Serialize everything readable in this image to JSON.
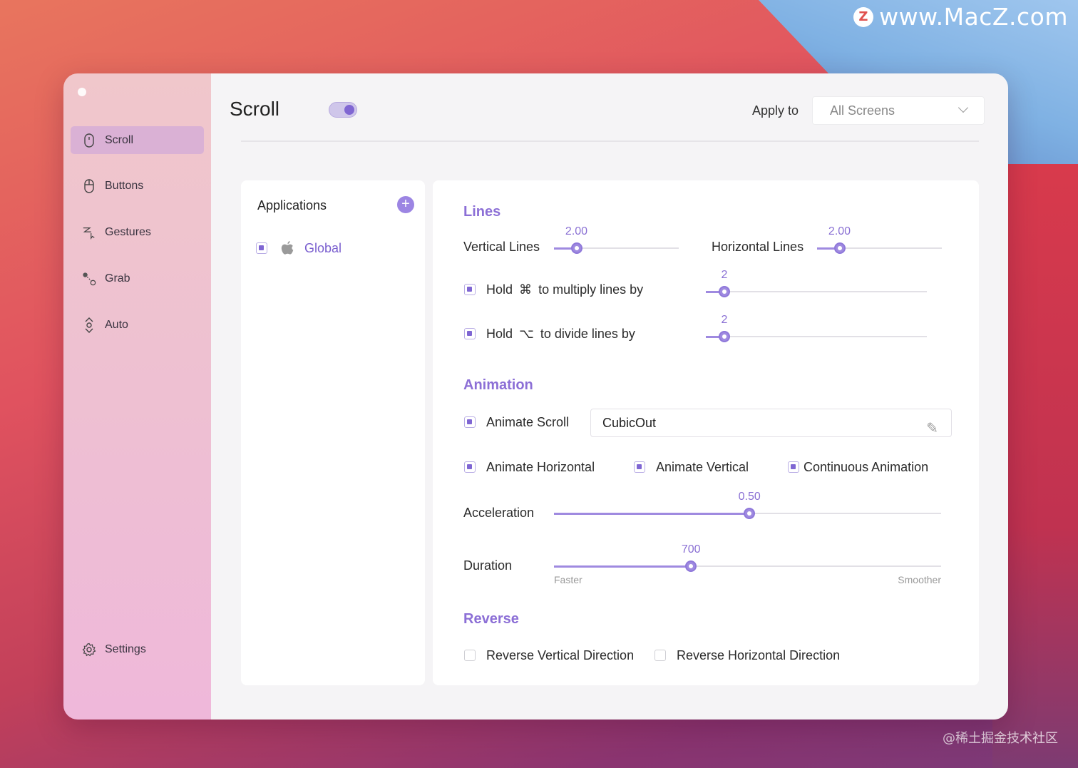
{
  "watermark": {
    "logo": "Z",
    "site": "www.MacZ.com",
    "bottom": "@稀土掘金技术社区"
  },
  "sidebar": {
    "items": [
      {
        "label": "Scroll",
        "icon": "mouse-icon"
      },
      {
        "label": "Buttons",
        "icon": "mouse-button-icon"
      },
      {
        "label": "Gestures",
        "icon": "gesture-icon"
      },
      {
        "label": "Grab",
        "icon": "grab-icon"
      },
      {
        "label": "Auto",
        "icon": "auto-scroll-icon"
      }
    ],
    "settings_label": "Settings"
  },
  "header": {
    "title": "Scroll",
    "toggle_on": true,
    "apply_label": "Apply to",
    "apply_value": "All Screens"
  },
  "apps": {
    "title": "Applications",
    "add_symbol": "+",
    "items": [
      {
        "label": "Global",
        "checked": true,
        "icon": "apple-icon"
      }
    ]
  },
  "lines": {
    "title": "Lines",
    "vertical_label": "Vertical Lines",
    "vertical_value": "2.00",
    "vertical_fraction": 0.18,
    "horizontal_label": "Horizontal Lines",
    "horizontal_value": "2.00",
    "horizontal_fraction": 0.18,
    "hold_cmd_prefix": "Hold",
    "hold_cmd_symbol": "⌘",
    "hold_cmd_suffix": "to multiply lines by",
    "hold_cmd_value": "2",
    "hold_cmd_checked": true,
    "hold_opt_prefix": "Hold",
    "hold_opt_symbol": "⌥",
    "hold_opt_suffix": "to divide lines by",
    "hold_opt_value": "2",
    "hold_opt_checked": true
  },
  "animation": {
    "title": "Animation",
    "animate_scroll_label": "Animate Scroll",
    "animate_scroll_checked": true,
    "curve_value": "CubicOut",
    "animate_horizontal_label": "Animate Horizontal",
    "animate_horizontal_checked": true,
    "animate_vertical_label": "Animate Vertical",
    "animate_vertical_checked": true,
    "continuous_label": "Continuous Animation",
    "continuous_checked": true,
    "acceleration_label": "Acceleration",
    "acceleration_value": "0.50",
    "acceleration_fraction": 0.505,
    "duration_label": "Duration",
    "duration_value": "700",
    "duration_fraction": 0.354,
    "duration_min_label": "Faster",
    "duration_max_label": "Smoother"
  },
  "reverse": {
    "title": "Reverse",
    "vertical_label": "Reverse Vertical Direction",
    "vertical_checked": false,
    "horizontal_label": "Reverse Horizontal Direction",
    "horizontal_checked": false
  },
  "colors": {
    "accent": "#8c6fd6",
    "slider": "#9f8ae0"
  }
}
